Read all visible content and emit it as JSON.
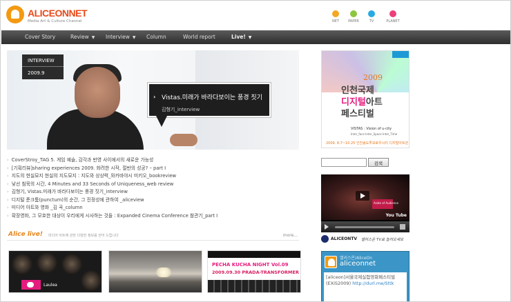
{
  "brand": {
    "name": "ALICEONNET",
    "tagline": "Media Art & Culture Channel",
    "accent": "#e84a1a"
  },
  "channels": [
    {
      "label": "NET",
      "color": "#f5a623"
    },
    {
      "label": "PAPER",
      "color": "#8dc63f"
    },
    {
      "label": "TV",
      "color": "#29abe2"
    },
    {
      "label": "PLANET",
      "color": "#ec407a"
    }
  ],
  "nav": {
    "items": [
      {
        "label": "Cover Story",
        "caret": false
      },
      {
        "label": "Review",
        "caret": true
      },
      {
        "label": "Interview",
        "caret": true
      },
      {
        "label": "Column",
        "caret": false
      },
      {
        "label": "World report",
        "caret": false
      },
      {
        "label": "Live!",
        "caret": true
      }
    ]
  },
  "feature": {
    "section": "INTERVIEW",
    "issue": "2009.9",
    "headline": "Vistas.미래가 바라다보이는 풍경 짓기",
    "byline": "김형기_interview"
  },
  "articles": [
    "CoverStroy_TAG 5. 게임 예술, 감각과 반영 사이에서의 새로운 가능성",
    "[기획리뷰]sharing experiences 2009. 화려한 시작, 절반의 성공? – part I",
    "지도의 현실묘지 현실의 지도묘지 : 지도와 상상력_와카바야시 미키오_bookreview",
    "낯선 침묵의 시간, 4 Minutes and 33 Seconds of Uniqueness_web review",
    "김형기, Vistas.미래가 바라다보이는 풍경 짓기_interview",
    "디지털 푼크툼(punctum)의 순간, 그 진정성에 관하여 _aliceview",
    "미디어 아트와 영화 _김 곡_column",
    "확장영화, 그 모호한 대상이 우리에게 시사하는 것들 : Expanded Cinema Conference 참관기_part I"
  ],
  "alice_live": {
    "title": "Alice live!",
    "description": "미디어 아트에 관한 다양한 정보를 얻어 드립니다",
    "more": "more..."
  },
  "thumbs": {
    "t1_label": "Laulea",
    "t3_line1": "PECHA KUCHA NIGHT Vol.09",
    "t3_line2": "2009.09.30 PRADA-TRANSFORMER"
  },
  "poster": {
    "year": "2009",
    "title_line1": "인천국제",
    "title_line2a": "디지털",
    "title_line2b": "아트",
    "title_line3": "페스티벌",
    "vistas": "VISTAS : Vision of u-city",
    "vistas_sub": "Inter_face  Inter_Space  Inter_Time",
    "dates": "2009. 8.7~10.25  인천송도투모로우시티 디지털아트관"
  },
  "search": {
    "placeholder": "",
    "button": "검색"
  },
  "video": {
    "overlay": "Aside of Audience",
    "yt": "You Tube"
  },
  "tv": {
    "logo": "ALICEONTV",
    "sign": "앨리스온 TV로 놀러오세요"
  },
  "twitter": {
    "name": "앨리스온/AliceOn",
    "handle": "aliceonnet",
    "body": "[aliceon]서울국제실험영화페스티벌 (EXiS2009)",
    "link": "http://durl.me/Sttk"
  }
}
